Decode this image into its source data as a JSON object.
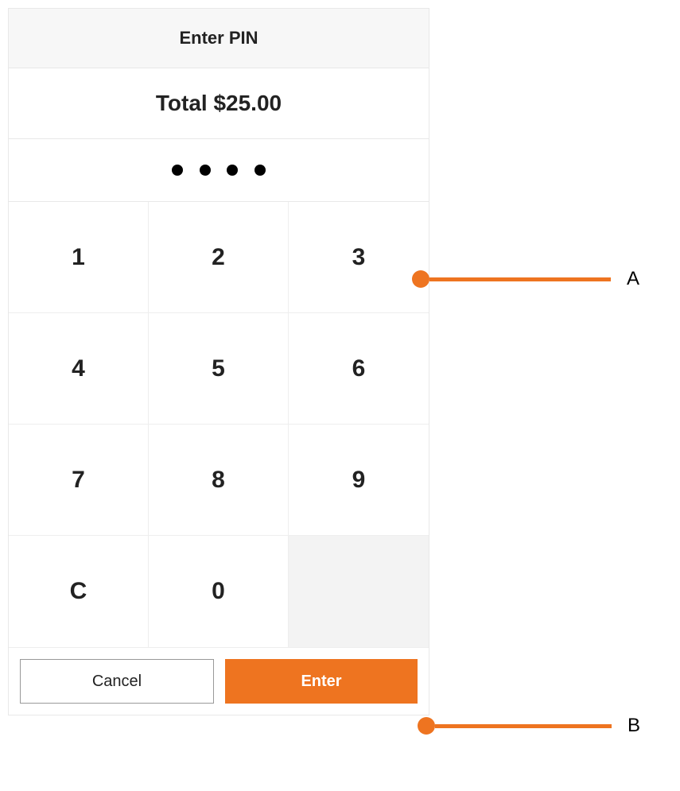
{
  "header": {
    "title": "Enter PIN"
  },
  "total": {
    "label": "Total $25.00"
  },
  "pin": {
    "length": 4
  },
  "keypad": {
    "keys": [
      {
        "label": "1",
        "type": "digit"
      },
      {
        "label": "2",
        "type": "digit"
      },
      {
        "label": "3",
        "type": "digit"
      },
      {
        "label": "4",
        "type": "digit"
      },
      {
        "label": "5",
        "type": "digit"
      },
      {
        "label": "6",
        "type": "digit"
      },
      {
        "label": "7",
        "type": "digit"
      },
      {
        "label": "8",
        "type": "digit"
      },
      {
        "label": "9",
        "type": "digit"
      },
      {
        "label": "C",
        "type": "clear"
      },
      {
        "label": "0",
        "type": "digit"
      },
      {
        "label": "",
        "type": "blank"
      }
    ]
  },
  "actions": {
    "cancel": "Cancel",
    "enter": "Enter"
  },
  "callouts": {
    "a": "A",
    "b": "B"
  }
}
